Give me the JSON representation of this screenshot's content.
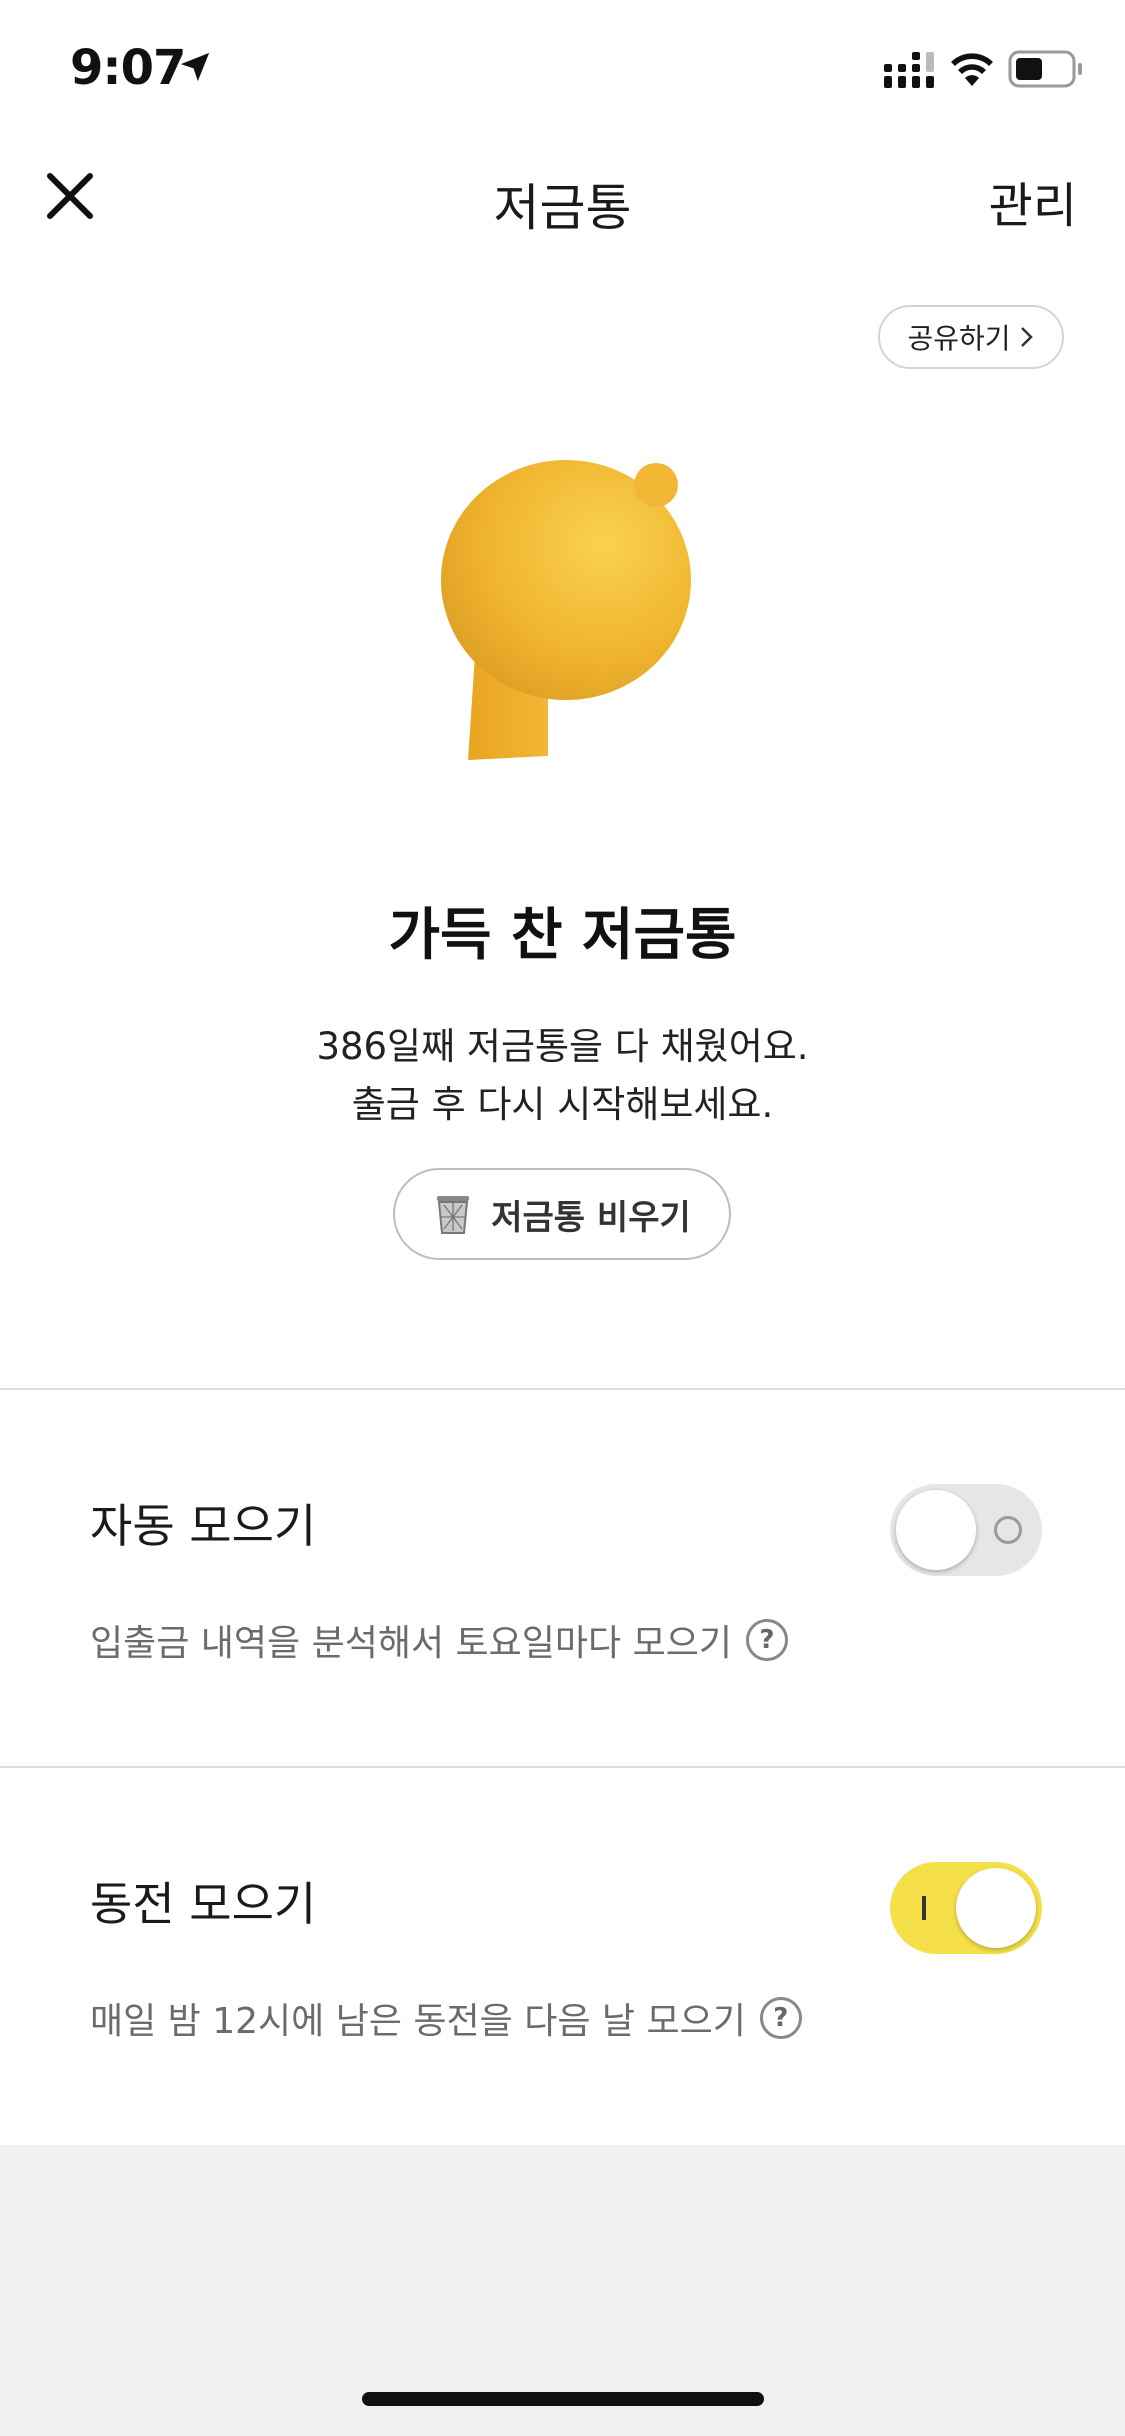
{
  "status_bar": {
    "time": "9:07",
    "icons": [
      "location-arrow-icon",
      "cellular-signal-icon",
      "wifi-icon",
      "battery-icon"
    ]
  },
  "nav": {
    "title": "저금통",
    "manage_label": "관리",
    "close_icon": "close-icon"
  },
  "share_label": "공유하기",
  "hero": {
    "title": "가득 찬 저금통",
    "desc_line1": "386일째 저금통을 다 채웠어요.",
    "desc_line2": "출금 후 다시 시작해보세요."
  },
  "empty_button": {
    "label": "저금통 비우기",
    "icon": "trash-bin-icon"
  },
  "settings": [
    {
      "title": "자동 모으기",
      "desc": "입출금 내역을 분석해서 토요일마다 모으기",
      "help": "?",
      "enabled": false
    },
    {
      "title": "동전 모으기",
      "desc": "매일 밤 12시에 남은 동전을 다음 날 모으기",
      "help": "?",
      "enabled": true
    }
  ],
  "colors": {
    "toggle_on": "#f6e04a",
    "toggle_off": "#e6e6e6",
    "character": "#f2b632",
    "footer_bg": "#f1f1f1"
  }
}
